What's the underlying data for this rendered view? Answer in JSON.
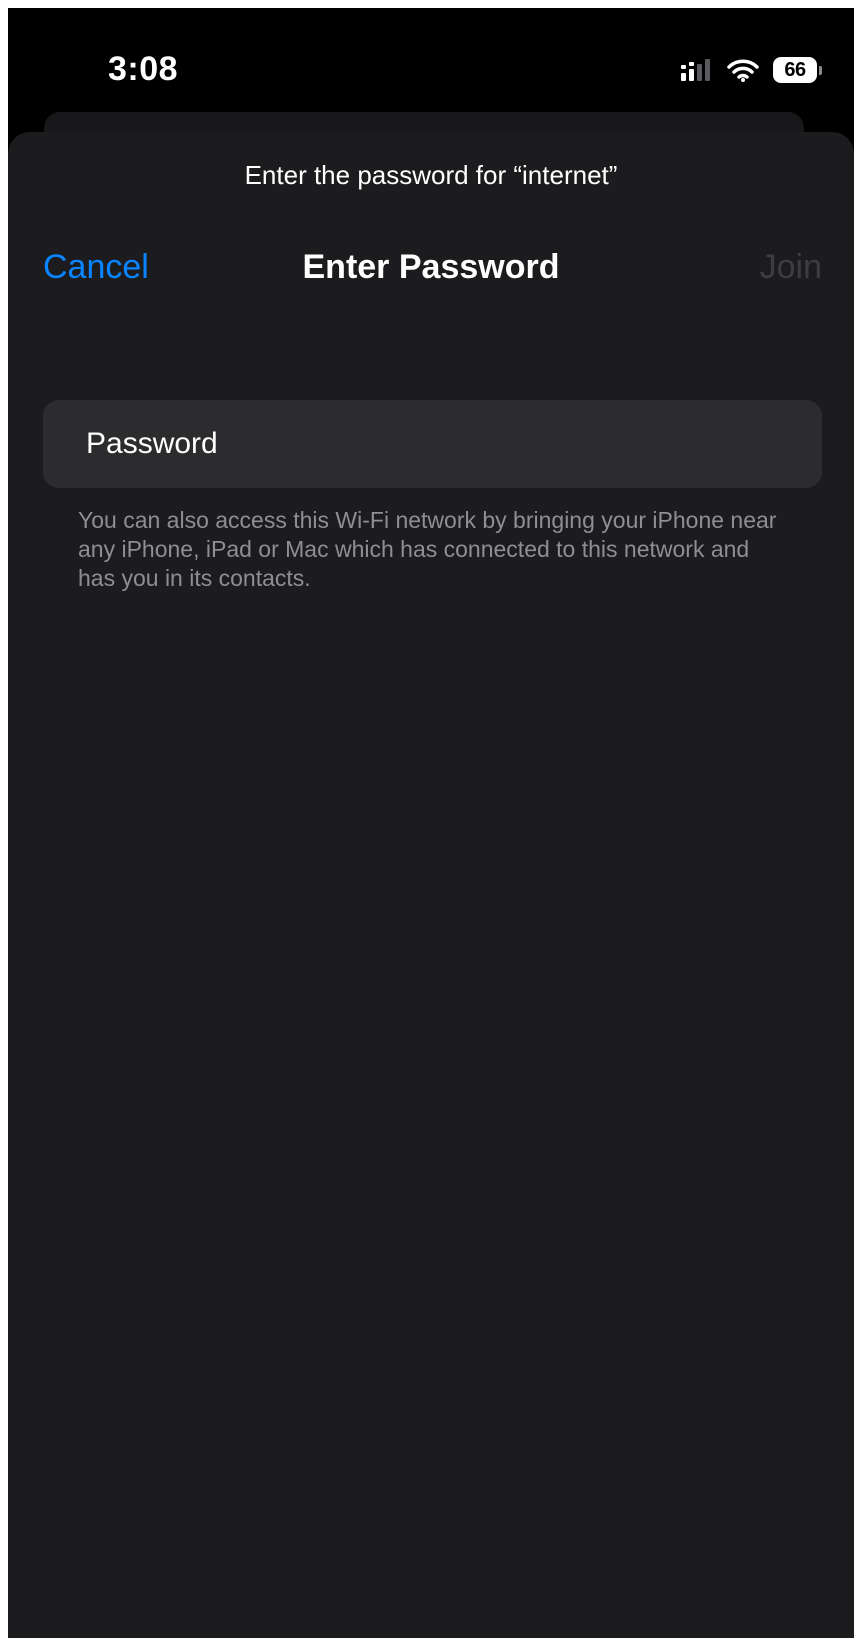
{
  "status_bar": {
    "time": "3:08",
    "battery": "66",
    "icons": [
      "cellular-signal-icon",
      "wifi-icon",
      "battery-icon"
    ]
  },
  "sheet": {
    "prompt": "Enter the password for “internet”",
    "nav": {
      "cancel_label": "Cancel",
      "title": "Enter Password",
      "join_label": "Join"
    },
    "password_field": {
      "placeholder": "Password",
      "value": ""
    },
    "footnote": "You can also access this Wi-Fi network by bringing your iPhone near any iPhone, iPad or Mac which has connected to this network and has you in its contacts."
  },
  "colors": {
    "background": "#000000",
    "sheet": "#1c1c1e",
    "field": "#2c2c2e",
    "accent": "#0a84ff",
    "disabled": "#3d3d41",
    "secondary_text": "#8e8e93"
  }
}
